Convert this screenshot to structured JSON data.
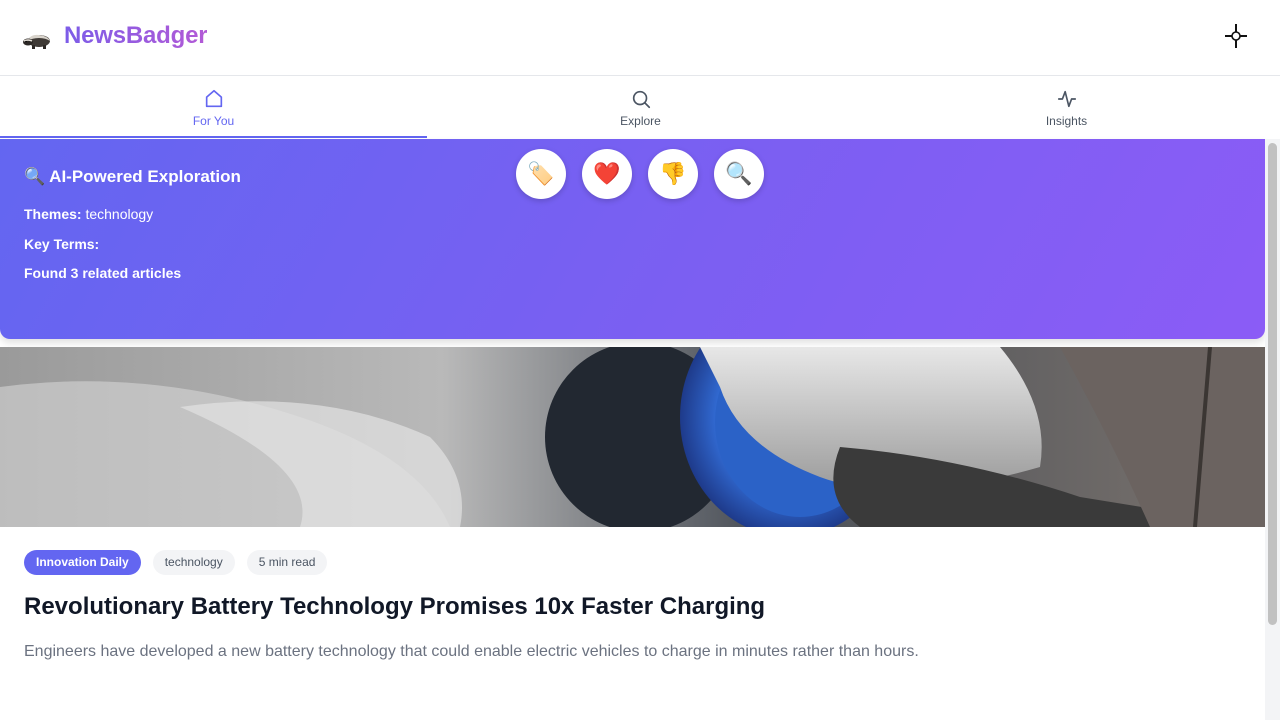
{
  "app": {
    "name": "NewsBadger",
    "logo_icon": "badger-icon",
    "settings_icon": "crosshair-icon"
  },
  "tabs": [
    {
      "label": "For You",
      "icon": "home-icon",
      "active": true
    },
    {
      "label": "Explore",
      "icon": "search-icon",
      "active": false
    },
    {
      "label": "Insights",
      "icon": "activity-icon",
      "active": false
    }
  ],
  "exploration": {
    "title": "AI-Powered Exploration",
    "title_icon": "magnifier-emoji",
    "themes_label": "Themes:",
    "themes_value": "technology",
    "key_terms_label": "Key Terms:",
    "key_terms_value": "",
    "found_text": "Found 3 related articles",
    "actions": [
      {
        "name": "tag-button",
        "icon": "tag-icon",
        "glyph": "🏷️"
      },
      {
        "name": "like-button",
        "icon": "heart-icon",
        "glyph": "❤️"
      },
      {
        "name": "dislike-button",
        "icon": "thumbs-down-icon",
        "glyph": "👎"
      },
      {
        "name": "explore-button",
        "icon": "magnifier-icon",
        "glyph": "🔍"
      }
    ]
  },
  "article": {
    "source": "Innovation Daily",
    "category": "technology",
    "read_time": "5 min read",
    "title": "Revolutionary Battery Technology Promises 10x Faster Charging",
    "summary": "Engineers have developed a new battery technology that could enable electric vehicles to charge in minutes rather than hours."
  },
  "colors": {
    "accent": "#6366f1",
    "gradient_end": "#8b5cf6",
    "logo_gradient": [
      "#7c5ce8",
      "#b35ad6"
    ]
  }
}
